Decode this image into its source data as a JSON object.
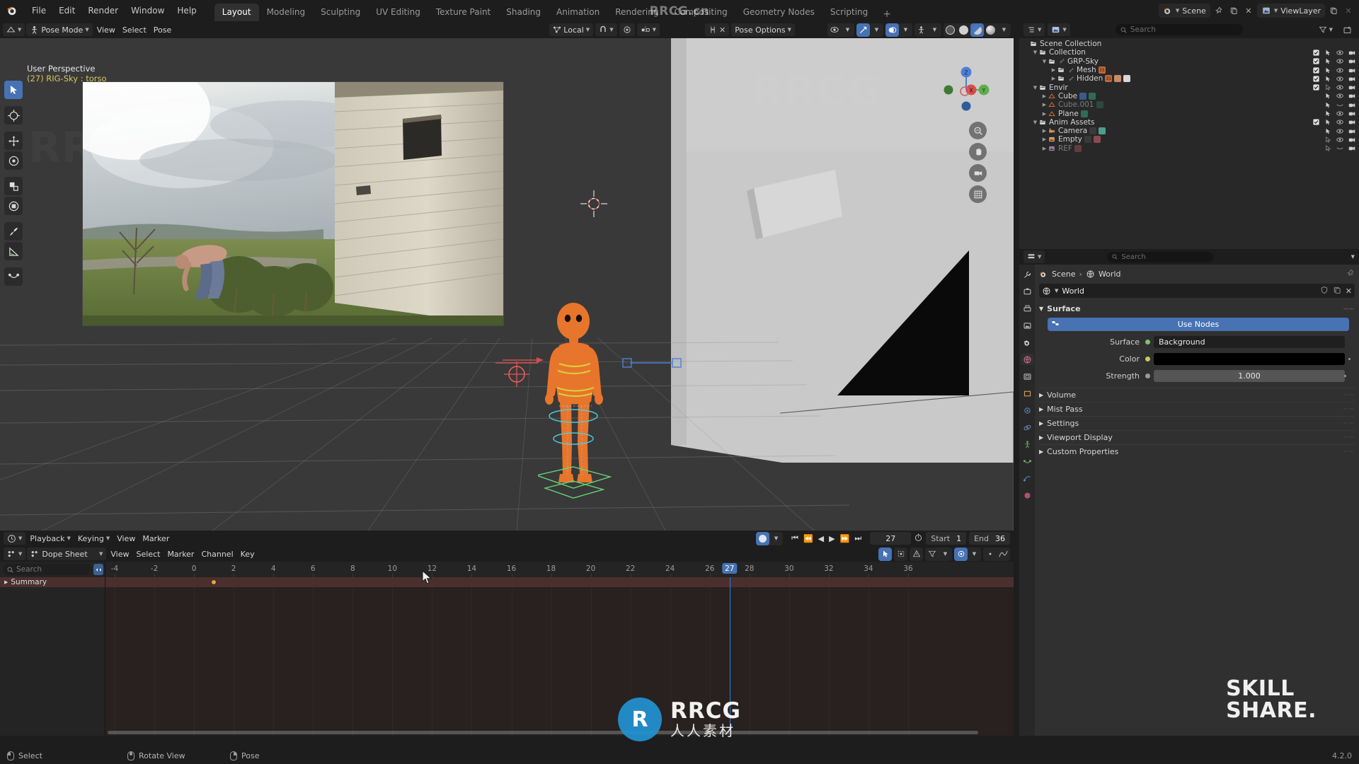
{
  "app": {
    "name": "Blender",
    "version": "4.2.0"
  },
  "topbar": {
    "menus": [
      "File",
      "Edit",
      "Render",
      "Window",
      "Help"
    ],
    "workspaces": [
      {
        "label": "Layout",
        "active": true
      },
      {
        "label": "Modeling",
        "active": false
      },
      {
        "label": "Sculpting",
        "active": false
      },
      {
        "label": "UV Editing",
        "active": false
      },
      {
        "label": "Texture Paint",
        "active": false
      },
      {
        "label": "Shading",
        "active": false
      },
      {
        "label": "Animation",
        "active": false
      },
      {
        "label": "Rendering",
        "active": false
      },
      {
        "label": "Compositing",
        "active": false
      },
      {
        "label": "Geometry Nodes",
        "active": false
      },
      {
        "label": "Scripting",
        "active": false
      }
    ],
    "add_workspace_label": "+",
    "scene_name": "Scene",
    "view_layer_name": "ViewLayer",
    "scene_icon": "scene-icon",
    "view_layer_icon": "view-layer-icon",
    "pin_icon": "pin-icon",
    "copy_icon": "duplicate-icon",
    "close_icon": "close-icon"
  },
  "viewport": {
    "mode": "Pose Mode",
    "menus": [
      "View",
      "Select",
      "Pose"
    ],
    "orientation": "Local",
    "pose_options_label": "Pose Options",
    "overlay_perspective": "User Perspective",
    "overlay_object": "(27) RIG-Sky : torso",
    "tools": [
      {
        "name": "tweak-select-tool",
        "active": true
      },
      {
        "name": "cursor-tool",
        "active": false
      },
      {
        "name": "move-tool",
        "active": false
      },
      {
        "name": "rotate-tool",
        "active": false
      },
      {
        "name": "scale-tool",
        "active": false
      },
      {
        "name": "transform-tool",
        "active": false
      },
      {
        "name": "annotate-tool",
        "active": false
      },
      {
        "name": "measure-tool",
        "active": false
      },
      {
        "name": "add-bone-tool",
        "active": false
      }
    ],
    "gizmo_axes": [
      "X",
      "Y",
      "Z"
    ],
    "nav_buttons": [
      "zoom-icon",
      "pan-icon",
      "camera-icon",
      "orthographic-icon"
    ],
    "shading_modes": [
      "wireframe",
      "solid",
      "material-preview",
      "rendered"
    ],
    "active_shading": "material-preview"
  },
  "timeline": {
    "menus": [
      "Playback",
      "Keying",
      "View",
      "Marker"
    ],
    "current_frame": "27",
    "start_label": "Start",
    "start_value": "1",
    "end_label": "End",
    "end_value": "36",
    "playback_icon": "auto-key-icon"
  },
  "dopesheet": {
    "editor_name": "Dope Sheet",
    "menus": [
      "View",
      "Select",
      "Marker",
      "Channel",
      "Key"
    ],
    "search_placeholder": "Search",
    "summary_label": "Summary",
    "ruler_ticks": [
      "-4",
      "-2",
      "0",
      "2",
      "4",
      "6",
      "8",
      "10",
      "12",
      "14",
      "16",
      "18",
      "20",
      "22",
      "24",
      "26",
      "28",
      "30",
      "32",
      "34",
      "36"
    ],
    "playhead_frame": "27",
    "keyframes": [
      1
    ]
  },
  "outliner": {
    "search_placeholder": "Search",
    "root": "Scene Collection",
    "items": [
      {
        "label": "Scene Collection",
        "indent": 0,
        "icon": "collection-icon",
        "expander": "",
        "dim": false,
        "checkbox": false,
        "controls": false
      },
      {
        "label": "Collection",
        "indent": 1,
        "icon": "collection-icon",
        "expander": "down",
        "dim": false,
        "checkbox": true,
        "controls": true
      },
      {
        "label": "GRP-Sky",
        "indent": 2,
        "icon": "collection-icon",
        "expander": "down",
        "dim": false,
        "checkbox": true,
        "controls": true
      },
      {
        "label": "Mesh",
        "indent": 3,
        "icon": "collection-icon",
        "expander": "right",
        "dim": false,
        "checkbox": true,
        "controls": true
      },
      {
        "label": "Hidden",
        "indent": 3,
        "icon": "collection-icon",
        "expander": "right",
        "dim": false,
        "checkbox": true,
        "controls": true
      },
      {
        "label": "Envir",
        "indent": 1,
        "icon": "collection-icon",
        "expander": "down",
        "dim": false,
        "checkbox": true,
        "controls": true
      },
      {
        "label": "Cube",
        "indent": 2,
        "icon": "mesh-icon",
        "expander": "right",
        "dim": false,
        "checkbox": false,
        "controls": true
      },
      {
        "label": "Cube.001",
        "indent": 2,
        "icon": "mesh-icon",
        "expander": "right",
        "dim": true,
        "checkbox": false,
        "controls": true
      },
      {
        "label": "Plane",
        "indent": 2,
        "icon": "mesh-icon",
        "expander": "right",
        "dim": false,
        "checkbox": false,
        "controls": true
      },
      {
        "label": "Anim Assets",
        "indent": 1,
        "icon": "collection-icon",
        "expander": "down",
        "dim": false,
        "checkbox": true,
        "controls": true
      },
      {
        "label": "Camera",
        "indent": 2,
        "icon": "camera-icon",
        "expander": "right",
        "dim": false,
        "checkbox": false,
        "controls": true
      },
      {
        "label": "Empty",
        "indent": 2,
        "icon": "empty-icon",
        "expander": "right",
        "dim": false,
        "checkbox": false,
        "controls": true
      },
      {
        "label": "REF",
        "indent": 2,
        "icon": "image-icon",
        "expander": "right",
        "dim": true,
        "checkbox": false,
        "controls": true
      }
    ]
  },
  "properties": {
    "search_placeholder": "Search",
    "breadcrumb": [
      "Scene",
      "World"
    ],
    "id_name": "World",
    "panels": {
      "surface": {
        "title": "Surface",
        "use_nodes_label": "Use Nodes",
        "rows": [
          {
            "label": "Surface",
            "value": "Background",
            "type": "enum",
            "socket": "#83c167"
          },
          {
            "label": "Color",
            "value": "",
            "type": "color",
            "socket": "#cbc95a"
          },
          {
            "label": "Strength",
            "value": "1.000",
            "type": "slider",
            "socket": "#9a9a9a"
          }
        ]
      },
      "collapsed": [
        "Volume",
        "Mist Pass",
        "Settings",
        "Viewport Display",
        "Custom Properties"
      ]
    }
  },
  "statusbar": {
    "items": [
      {
        "label": "Select",
        "mouse": "left"
      },
      {
        "label": "Rotate View",
        "mouse": "middle"
      },
      {
        "label": "Pose",
        "mouse": "right"
      }
    ],
    "version": "4.2.0"
  },
  "watermarks": {
    "top": "RRCG.cn",
    "logo_letter": "R",
    "brand_line1": "RRCG",
    "brand_line2": "人人素材",
    "corner_line1": "SKILL",
    "corner_line2": "SHARE."
  },
  "colors": {
    "accent_blue": "#4772b3",
    "playhead_blue": "#2a7fd6",
    "summary_red": "#4b2f2f",
    "keyframe_orange": "#e8a33d",
    "highlight_yellow": "#d6c85a"
  }
}
